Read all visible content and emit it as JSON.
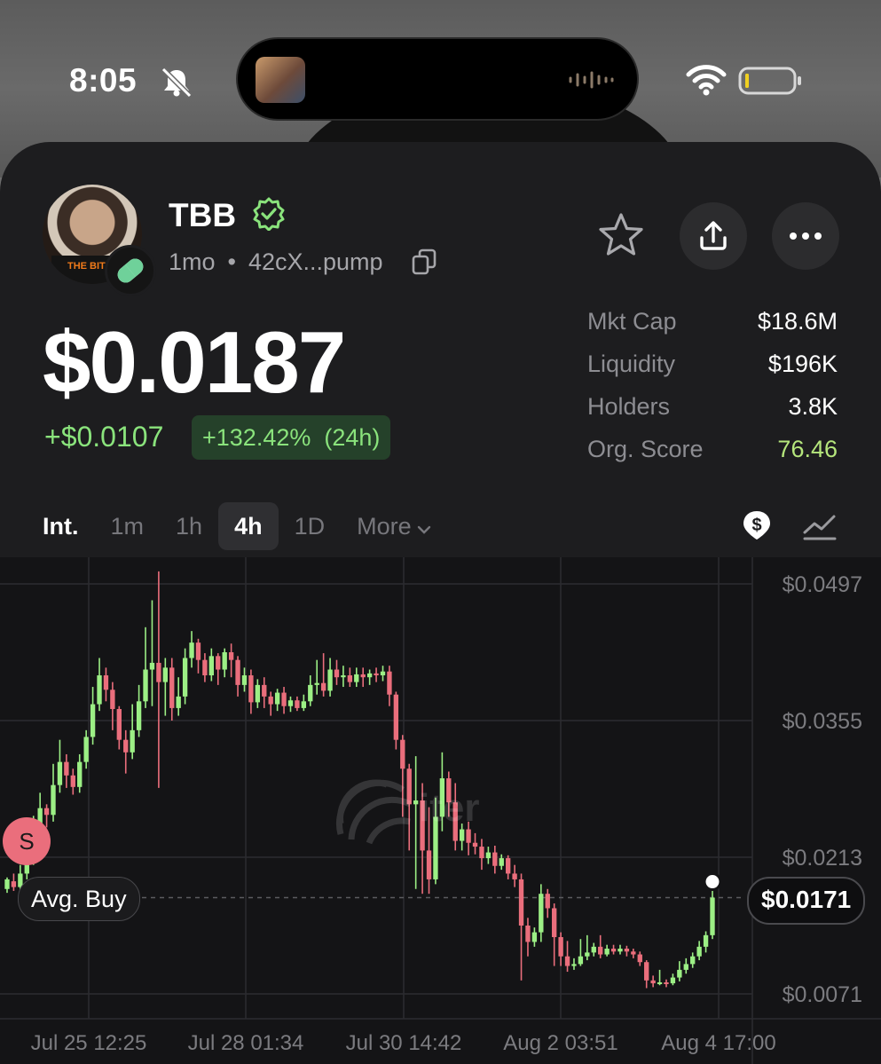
{
  "status_bar": {
    "time": "8:05",
    "icons": [
      "bell-slash-icon",
      "wifi-icon",
      "battery-icon"
    ]
  },
  "token": {
    "name": "TBB",
    "age": "1mo",
    "address": "42cX...pump",
    "avatar_text": "THE BITCOIN",
    "price": "$0.0187",
    "change_abs": "+$0.0107",
    "change_pct": "+132.42%",
    "change_period": "(24h)"
  },
  "actions": {
    "icons": [
      "star-icon",
      "share-icon",
      "more-icon"
    ]
  },
  "stats": [
    {
      "label": "Mkt Cap",
      "value": "$18.6M"
    },
    {
      "label": "Liquidity",
      "value": "$196K"
    },
    {
      "label": "Holders",
      "value": "3.8K"
    },
    {
      "label": "Org. Score",
      "value": "76.46"
    }
  ],
  "timeframe": {
    "label": "Int.",
    "options": [
      "1m",
      "1h",
      "4h",
      "1D",
      "More"
    ],
    "selected": "4h"
  },
  "chart": {
    "avg_buy_label": "Avg. Buy",
    "last_price": "$0.0171",
    "sell_marker": "S",
    "watermark": "iter",
    "y_ticks": [
      "$0.0497",
      "$0.0355",
      "$0.0213",
      "$0.0071"
    ],
    "x_ticks": [
      "Jul 25 12:25",
      "Jul 28 01:34",
      "Jul 30 14:42",
      "Aug 2 03:51",
      "Aug 4 17:00"
    ]
  },
  "colors": {
    "up": "#9cef85",
    "down": "#ea6e7c",
    "accent_green": "#8ae37c",
    "background": "#1d1d1f"
  },
  "chart_data": {
    "type": "candlestick",
    "ylim": [
      0.0045,
      0.053
    ],
    "x_ticks": [
      "Jul 25 12:25",
      "Jul 28 01:34",
      "Jul 30 14:42",
      "Aug 2 03:51",
      "Aug 4 17:00"
    ],
    "y_ticks": [
      0.0497,
      0.0355,
      0.0213,
      0.0071
    ],
    "last_price": 0.0171,
    "candles": [
      [
        0.018,
        0.019,
        0.0176,
        0.0192
      ],
      [
        0.0188,
        0.0182,
        0.0178,
        0.0196
      ],
      [
        0.0182,
        0.0196,
        0.0178,
        0.0205
      ],
      [
        0.0196,
        0.0211,
        0.019,
        0.0225
      ],
      [
        0.0211,
        0.0235,
        0.0205,
        0.0256
      ],
      [
        0.0235,
        0.0264,
        0.023,
        0.028
      ],
      [
        0.0264,
        0.0257,
        0.0244,
        0.0268
      ],
      [
        0.0257,
        0.0288,
        0.025,
        0.031
      ],
      [
        0.0288,
        0.0312,
        0.028,
        0.0335
      ],
      [
        0.0312,
        0.0298,
        0.0285,
        0.032
      ],
      [
        0.0298,
        0.0286,
        0.0278,
        0.0305
      ],
      [
        0.0286,
        0.0312,
        0.028,
        0.032
      ],
      [
        0.0312,
        0.0338,
        0.0305,
        0.0345
      ],
      [
        0.0338,
        0.0372,
        0.033,
        0.039
      ],
      [
        0.0372,
        0.0402,
        0.0365,
        0.042
      ],
      [
        0.0402,
        0.0387,
        0.0375,
        0.041
      ],
      [
        0.0387,
        0.0367,
        0.0345,
        0.0395
      ],
      [
        0.0367,
        0.0335,
        0.0325,
        0.037
      ],
      [
        0.0335,
        0.0322,
        0.03,
        0.0345
      ],
      [
        0.0322,
        0.0345,
        0.0315,
        0.0372
      ],
      [
        0.0345,
        0.0375,
        0.0338,
        0.0392
      ],
      [
        0.0375,
        0.0408,
        0.0368,
        0.0452
      ],
      [
        0.0408,
        0.0415,
        0.037,
        0.048
      ],
      [
        0.0415,
        0.0395,
        0.0285,
        0.051
      ],
      [
        0.0395,
        0.041,
        0.036,
        0.042
      ],
      [
        0.041,
        0.0368,
        0.0355,
        0.042
      ],
      [
        0.0368,
        0.038,
        0.036,
        0.04
      ],
      [
        0.038,
        0.042,
        0.0372,
        0.043
      ],
      [
        0.042,
        0.0436,
        0.041,
        0.0448
      ],
      [
        0.0436,
        0.0418,
        0.0404,
        0.044
      ],
      [
        0.0418,
        0.0402,
        0.0395,
        0.0425
      ],
      [
        0.0402,
        0.0422,
        0.0396,
        0.043
      ],
      [
        0.0422,
        0.0408,
        0.0392,
        0.0425
      ],
      [
        0.0408,
        0.0426,
        0.04,
        0.043
      ],
      [
        0.0426,
        0.0418,
        0.04,
        0.0435
      ],
      [
        0.0418,
        0.0392,
        0.038,
        0.0422
      ],
      [
        0.0392,
        0.0402,
        0.0385,
        0.041
      ],
      [
        0.0402,
        0.0374,
        0.0362,
        0.0408
      ],
      [
        0.0374,
        0.0392,
        0.0368,
        0.0398
      ],
      [
        0.0392,
        0.038,
        0.0368,
        0.04
      ],
      [
        0.038,
        0.0372,
        0.036,
        0.0385
      ],
      [
        0.0372,
        0.0384,
        0.0365,
        0.0388
      ],
      [
        0.0384,
        0.037,
        0.0362,
        0.039
      ],
      [
        0.037,
        0.0376,
        0.0364,
        0.038
      ],
      [
        0.0376,
        0.0368,
        0.0365,
        0.038
      ],
      [
        0.0368,
        0.0375,
        0.0365,
        0.0382
      ],
      [
        0.0375,
        0.0392,
        0.037,
        0.0402
      ],
      [
        0.0392,
        0.0394,
        0.0382,
        0.0418
      ],
      [
        0.0394,
        0.0386,
        0.038,
        0.0425
      ],
      [
        0.0386,
        0.0408,
        0.038,
        0.042
      ],
      [
        0.0408,
        0.04,
        0.0392,
        0.0418
      ],
      [
        0.04,
        0.0402,
        0.039,
        0.0412
      ],
      [
        0.0402,
        0.0395,
        0.039,
        0.041
      ],
      [
        0.0395,
        0.0403,
        0.039,
        0.041
      ],
      [
        0.0403,
        0.04,
        0.039,
        0.041
      ],
      [
        0.04,
        0.0404,
        0.0392,
        0.0408
      ],
      [
        0.0404,
        0.0402,
        0.0395,
        0.041
      ],
      [
        0.0402,
        0.0406,
        0.0396,
        0.0412
      ],
      [
        0.0406,
        0.0382,
        0.037,
        0.0412
      ],
      [
        0.0382,
        0.0335,
        0.0325,
        0.0385
      ],
      [
        0.0335,
        0.0305,
        0.0255,
        0.034
      ],
      [
        0.0305,
        0.0268,
        0.022,
        0.031
      ],
      [
        0.0268,
        0.0272,
        0.018,
        0.0318
      ],
      [
        0.0272,
        0.022,
        0.0175,
        0.029
      ],
      [
        0.022,
        0.019,
        0.0175,
        0.0265
      ],
      [
        0.019,
        0.0255,
        0.0185,
        0.0275
      ],
      [
        0.0255,
        0.0295,
        0.024,
        0.0322
      ],
      [
        0.0295,
        0.027,
        0.0255,
        0.0302
      ],
      [
        0.027,
        0.023,
        0.022,
        0.029
      ],
      [
        0.023,
        0.0242,
        0.022,
        0.0248
      ],
      [
        0.0242,
        0.0228,
        0.0215,
        0.025
      ],
      [
        0.0228,
        0.0224,
        0.0216,
        0.0238
      ],
      [
        0.0224,
        0.0212,
        0.02,
        0.0232
      ],
      [
        0.0212,
        0.0218,
        0.0206,
        0.0224
      ],
      [
        0.0218,
        0.0204,
        0.0196,
        0.0225
      ],
      [
        0.0204,
        0.0212,
        0.02,
        0.0216
      ],
      [
        0.0212,
        0.0196,
        0.019,
        0.0215
      ],
      [
        0.0196,
        0.019,
        0.0182,
        0.0205
      ],
      [
        0.019,
        0.0142,
        0.0085,
        0.0196
      ],
      [
        0.0142,
        0.0125,
        0.011,
        0.015
      ],
      [
        0.0125,
        0.0135,
        0.012,
        0.014
      ],
      [
        0.0135,
        0.0175,
        0.0125,
        0.0185
      ],
      [
        0.0175,
        0.016,
        0.015,
        0.018
      ],
      [
        0.016,
        0.013,
        0.01,
        0.0165
      ],
      [
        0.013,
        0.011,
        0.01,
        0.0135
      ],
      [
        0.011,
        0.01,
        0.0094,
        0.0126
      ],
      [
        0.01,
        0.0102,
        0.0096,
        0.0108
      ],
      [
        0.0102,
        0.011,
        0.01,
        0.0128
      ],
      [
        0.011,
        0.0114,
        0.0106,
        0.0132
      ],
      [
        0.0114,
        0.012,
        0.011,
        0.0124
      ],
      [
        0.012,
        0.0112,
        0.0108,
        0.0132
      ],
      [
        0.0112,
        0.0118,
        0.011,
        0.0122
      ],
      [
        0.0118,
        0.0115,
        0.0112,
        0.0122
      ],
      [
        0.0115,
        0.0118,
        0.0112,
        0.0122
      ],
      [
        0.0118,
        0.0115,
        0.011,
        0.0121
      ],
      [
        0.0115,
        0.0112,
        0.0108,
        0.0118
      ],
      [
        0.0112,
        0.0104,
        0.01,
        0.0115
      ],
      [
        0.0104,
        0.0085,
        0.0077,
        0.0106
      ],
      [
        0.0085,
        0.0082,
        0.0078,
        0.009
      ],
      [
        0.0082,
        0.0083,
        0.008,
        0.0096
      ],
      [
        0.0083,
        0.0082,
        0.0078,
        0.0086
      ],
      [
        0.0082,
        0.0088,
        0.008,
        0.0092
      ],
      [
        0.0088,
        0.0096,
        0.0084,
        0.0105
      ],
      [
        0.0096,
        0.0102,
        0.0092,
        0.0108
      ],
      [
        0.0102,
        0.011,
        0.0098,
        0.0114
      ],
      [
        0.011,
        0.012,
        0.0106,
        0.0126
      ],
      [
        0.012,
        0.0132,
        0.0114,
        0.0136
      ],
      [
        0.0132,
        0.0171,
        0.0128,
        0.0192
      ]
    ]
  }
}
